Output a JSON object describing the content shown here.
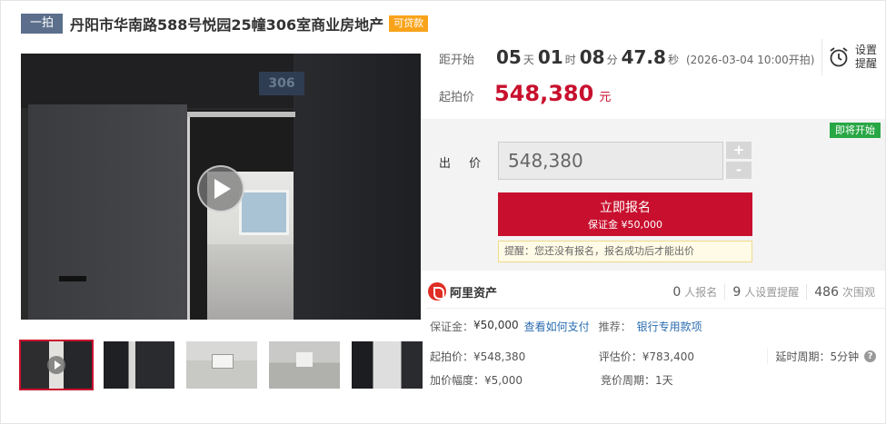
{
  "header": {
    "round_tag": "一拍",
    "title": "丹阳市华南路588号悦园25幢306室商业房地产",
    "loan_tag": "可贷款"
  },
  "media": {
    "door_sign": "306",
    "play_icon": "play-icon",
    "thumbnail_count": 5
  },
  "countdown": {
    "label": "距开始",
    "days": "05",
    "days_unit": "天",
    "hours": "01",
    "hours_unit": "时",
    "minutes": "08",
    "minutes_unit": "分",
    "seconds": "47.8",
    "seconds_unit": "秒",
    "start_note": "(2026-03-04 10:00开拍)"
  },
  "reminder": {
    "label": "设置提醒",
    "icon": "alarm-clock-icon"
  },
  "start_price": {
    "label": "起拍价",
    "value": "548,380",
    "unit": "元"
  },
  "bid": {
    "status_badge": "即将开始",
    "label": "出 价",
    "value": "548,380",
    "plus": "+",
    "minus": "-",
    "signup_label": "立即报名",
    "signup_deposit": "保证金 ¥50,000",
    "hint": "提醒：您还没有报名，报名成功后才能出价"
  },
  "platform": {
    "name": "阿里资产",
    "icon": "ali-assets-logo-icon"
  },
  "stats": {
    "signups": "0",
    "signups_label": "人报名",
    "reminders": "9",
    "reminders_label": "人设置提醒",
    "views": "486",
    "views_label": "次围观"
  },
  "deposit": {
    "label": "保证金：",
    "value": "¥50,000",
    "link": "查看如何支付",
    "recommend_label": "推荐：",
    "recommend_link": "银行专用款项"
  },
  "details": {
    "start_price": "起拍价：¥548,380",
    "appraisal": "评估价：¥783,400",
    "delay_period": "延时周期：5分钟",
    "increment": "加价幅度：¥5,000",
    "bid_period": "竞价周期：1天"
  },
  "colors": {
    "accent": "#c8102e",
    "loan_tag": "#f9a31b",
    "badge": "#28a745",
    "link": "#2b6cb0"
  }
}
